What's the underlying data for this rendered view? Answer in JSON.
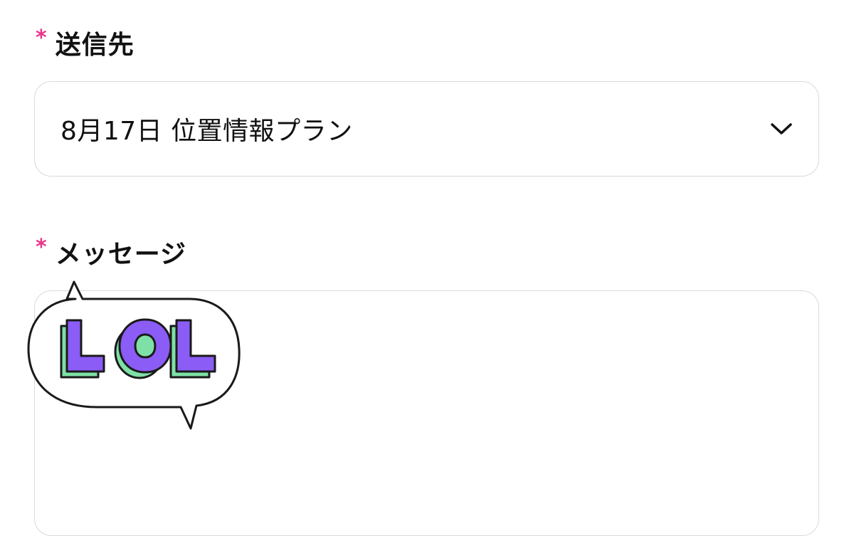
{
  "form": {
    "recipient": {
      "required_mark": "*",
      "label": "送信先",
      "selected_value": "8月17日 位置情報プラン"
    },
    "message": {
      "required_mark": "*",
      "label": "メッセージ",
      "sticker": {
        "text": "LOL",
        "icon": "lol-speech-bubble-sticker"
      }
    }
  },
  "colors": {
    "required_mark": "#e8358a",
    "border": "#d9d9d9",
    "sticker_letters": "#8b5cf6",
    "sticker_shadow": "#7ee0a6",
    "sticker_outline": "#111111"
  }
}
